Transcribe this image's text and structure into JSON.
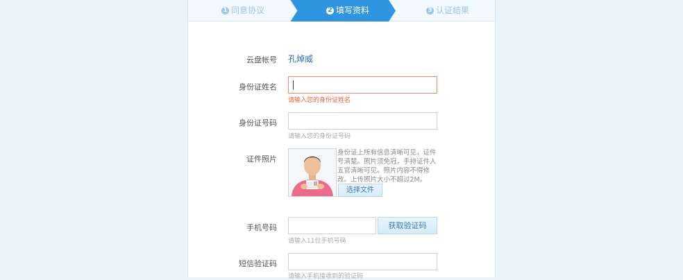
{
  "steps": [
    {
      "num": "1",
      "label": "同意协议",
      "state": "done"
    },
    {
      "num": "2",
      "label": "填写资料",
      "state": "active"
    },
    {
      "num": "3",
      "label": "认证结果",
      "state": "todo"
    }
  ],
  "colors": {
    "accent": "#2f95e0",
    "step_inactive_bg": "#f1f8fe",
    "error": "#e5633f",
    "page_bg": "#e8f3fc"
  },
  "form": {
    "account": {
      "label": "云盘帐号",
      "value": "孔焯威"
    },
    "name": {
      "label": "身份证姓名",
      "value": "",
      "hint": "请输入您的身份证姓名"
    },
    "id_number": {
      "label": "身份证号码",
      "value": "",
      "hint": "请输入您的身份证号码"
    },
    "photo": {
      "label": "证件照片",
      "description": "身份证上所有信息清晰可见，证件号清楚。照片须免冠，手持证件人五官清晰可见。照片内容不得修改。上传照片大小不超过2M。",
      "button": "选择文件"
    },
    "phone": {
      "label": "手机号码",
      "value": "",
      "hint": "请输入11位手机号码",
      "button": "获取验证码"
    },
    "sms": {
      "label": "短信验证码",
      "value": "",
      "hint": "请输入手机接收到的验证码"
    }
  }
}
